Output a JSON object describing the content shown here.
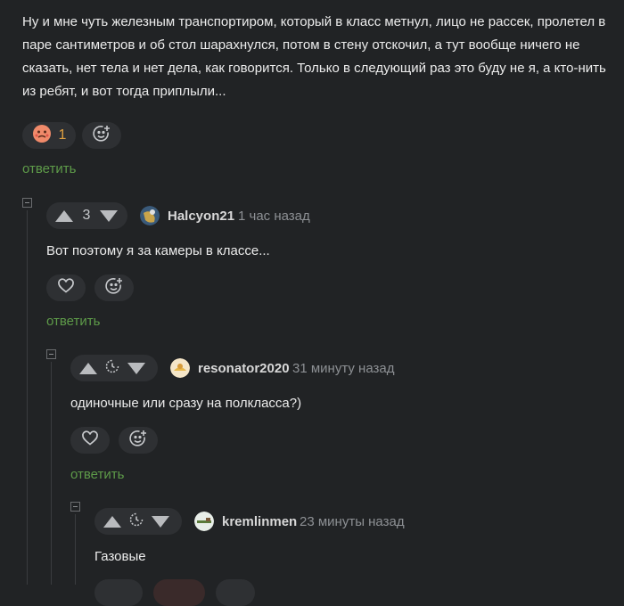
{
  "top_comment": {
    "text": "Ну и мне чуть железным транспортиром, который в класс метнул, лицо не рассек, пролетел в паре сантиметров и об стол шарахнулся, потом в стену отскочил, а тут вообще ничего не сказать, нет тела и нет дела, как говорится. Только в следующий раз это буду не я, а кто-нить из ребят, и вот тогда приплыли...",
    "reaction_count": "1",
    "reply_label": "ответить"
  },
  "comments": [
    {
      "score": "3",
      "username": "Halcyon21",
      "time": "1 час назад",
      "text": "Вот поэтому я за камеры в классе...",
      "reply_label": "ответить"
    },
    {
      "username": "resonator2020",
      "time": "31 минуту назад",
      "text": "одиночные или сразу на полкласса?)",
      "reply_label": "ответить"
    },
    {
      "username": "kremlinmen",
      "time": "23 минуты назад",
      "text": "Газовые"
    }
  ],
  "colors": {
    "background": "#212325",
    "reply_link": "#5e9b49",
    "pill": "#2e3033"
  },
  "icons": [
    "upvote-icon",
    "downvote-icon",
    "clock-icon",
    "heart-icon",
    "add-reaction-icon",
    "emoji-hot-face-icon",
    "collapse-icon"
  ]
}
